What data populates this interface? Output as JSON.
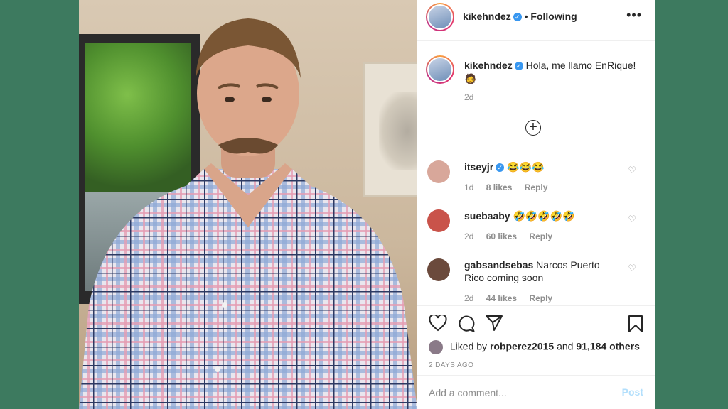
{
  "post": {
    "username": "kikehndez",
    "follow_separator": "•",
    "follow_label": "Following",
    "more_icon": "more-icon",
    "caption": {
      "username": "kikehndez",
      "text": "Hola, me llamo EnRique!",
      "emoji": "🧔",
      "time": "2d"
    },
    "load_more_icon": "plus-circle-icon",
    "comments": [
      {
        "username": "itseyjr",
        "verified": true,
        "text": "😂😂😂",
        "time": "1d",
        "likes": "8 likes",
        "reply": "Reply",
        "avatar_color": "#d8a79a"
      },
      {
        "username": "suebaaby",
        "verified": false,
        "text": "🤣🤣🤣🤣🤣",
        "time": "2d",
        "likes": "60 likes",
        "reply": "Reply",
        "avatar_color": "#c9534a"
      },
      {
        "username": "gabsandsebas",
        "verified": false,
        "text": "Narcos Puerto Rico coming soon",
        "time": "2d",
        "likes": "44 likes",
        "reply": "Reply",
        "avatar_color": "#6b4a3c"
      }
    ],
    "liked_by": {
      "prefix": "Liked by",
      "user": "robperez2015",
      "joiner": "and",
      "others": "91,184 others"
    },
    "time_ago": "2 DAYS AGO",
    "comment_placeholder": "Add a comment...",
    "post_label": "Post"
  },
  "colors": {
    "background": "#3d7a5f",
    "verified": "#3897f0",
    "post_disabled": "#b2dffc"
  }
}
